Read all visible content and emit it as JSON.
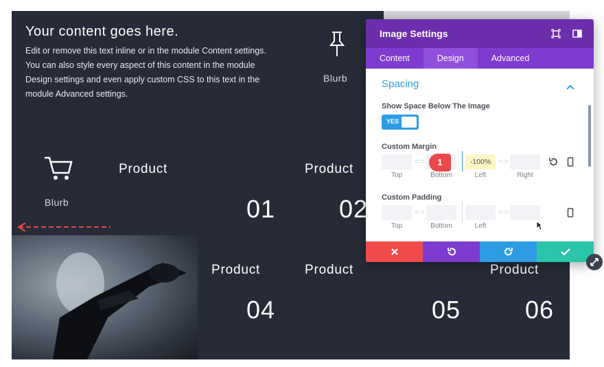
{
  "canvas": {
    "text_module": {
      "title": "Your content goes here.",
      "body": "Edit or remove this text inline or in the module Content settings. You can also style every aspect of this content in the module Design settings and even apply custom CSS to this text in the module Advanced settings."
    },
    "blurbs": [
      {
        "label": "Blurb",
        "icon": "pushpin-icon"
      },
      {
        "label": "Blurb",
        "icon": "cart-icon"
      }
    ],
    "products": [
      {
        "label": "Product",
        "number": ""
      },
      {
        "label": "Product",
        "number": "01"
      },
      {
        "label": "",
        "number": "02"
      },
      {
        "label": "Product",
        "number": "04"
      },
      {
        "label": "Product",
        "number": ""
      },
      {
        "label": "Product",
        "number": "05"
      },
      {
        "label": "",
        "number": "06"
      }
    ]
  },
  "panel": {
    "title": "Image Settings",
    "tabs": [
      "Content",
      "Design",
      "Advanced"
    ],
    "active_tab": "Design",
    "section": "Spacing",
    "show_space_label": "Show Space Below The Image",
    "toggle_text": "YES",
    "custom_margin": {
      "label": "Custom Margin",
      "fields": {
        "top": "",
        "bottom": "",
        "left": "-100%",
        "right": ""
      },
      "sublabels": [
        "Top",
        "Bottom",
        "Left",
        "Right"
      ]
    },
    "custom_padding": {
      "label": "Custom Padding",
      "sublabels": [
        "Top",
        "Bottom",
        "Left"
      ]
    },
    "annotation_marker": "1",
    "colors": {
      "header": "#6c2ead",
      "tabs": "#7e3bd0",
      "accent": "#2e9ce5",
      "cancel": "#ef4b4b",
      "undo": "#7e3bd0",
      "redo": "#2e9ce5",
      "save": "#29c4a9"
    }
  }
}
